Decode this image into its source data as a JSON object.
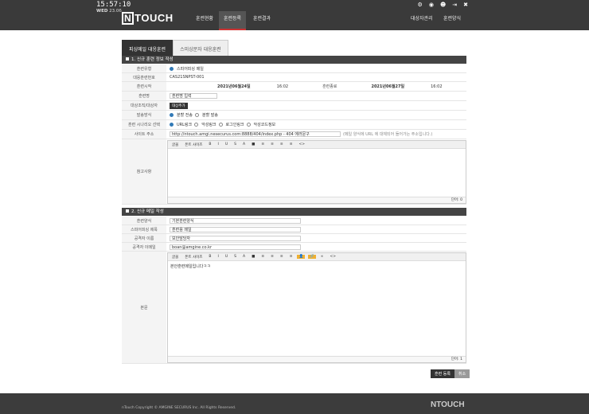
{
  "header": {
    "time": "15:57:10",
    "weekday": "WED",
    "date": "23.06",
    "logo": "NTOUCH",
    "nav": [
      "훈련현황",
      "훈련등록",
      "훈련결과",
      "대상자관리",
      "훈련양식"
    ],
    "icons": [
      "gear-icon",
      "eye-icon",
      "user-icon",
      "logout-icon",
      "close-icon"
    ]
  },
  "tabs": [
    "피싱메일 대응훈련",
    "스미싱문자 대응훈련"
  ],
  "section1": {
    "title": "1. 신규 훈련 정보 작성",
    "type_label": "훈련유형",
    "type_value": "스피어피싱 메일",
    "id_label": "대응훈련번호",
    "id_value": "CAS21SNPST-001",
    "start_label": "훈련시작",
    "start_date": "2021년06월24일",
    "start_time": "16:02",
    "end_label": "훈련종료",
    "end_date": "2021년06월27일",
    "end_time": "16:02",
    "name_label": "훈련명",
    "name_value": "훈련명 입력",
    "target_label": "대상조직/대상자",
    "target_btn": "대상추가",
    "send_label": "발송방식",
    "send_opt1": "분할 전송",
    "send_opt2": "분할 발송",
    "scenario_label": "훈련 시나리오 선택",
    "scen1": "URL링크",
    "scen2": "악성링크",
    "scen3": "로그인링크",
    "scen4": "악성코드정보",
    "site_label": "사이트 주소",
    "site_value": "http://ntouch.amgi.nesecurus.com:8888/404/index.php - 404 에러문구",
    "site_hint": "(메일 양식에 URL 에 대체되어 들어가는 주소입니다.)",
    "note_label": "참고사항",
    "editor_toolbar": [
      "글꼴",
      "폰트 사이즈",
      "B",
      "I",
      "U",
      "S",
      "A",
      "■",
      "≡",
      "≡",
      "≡",
      "≡",
      "<>"
    ],
    "editor_status": "단어: 0"
  },
  "section2": {
    "title": "2. 신규 메일 작성",
    "form_label": "훈련양식",
    "form_value": "기본훈련양식",
    "subject_label": "스피어피싱 제목",
    "subject_value": "훈련용 메일",
    "sender_label": "공격자 이름",
    "sender_value": "보안담당자",
    "email_label": "공격자 이메일",
    "email_value": "boan@amgine.co.kr",
    "body_label": "본문",
    "body_text": "본안훈련메일입니다ㅋㅋ",
    "editor_toolbar": [
      "글꼴",
      "폰트 사이즈",
      "B",
      "I",
      "U",
      "S",
      "A",
      "■",
      "≡",
      "≡",
      "≡",
      "≡",
      "👤",
      "🔗",
      "∞",
      "<>"
    ],
    "editor_status": "단어: 1"
  },
  "buttons": {
    "register": "훈련 등록",
    "cancel": "취소"
  },
  "footer": {
    "copyright": "nTouch Copyright © AMGINE SECURUS Inc. All Rights Reserved.",
    "logo": "NTOUCH"
  }
}
